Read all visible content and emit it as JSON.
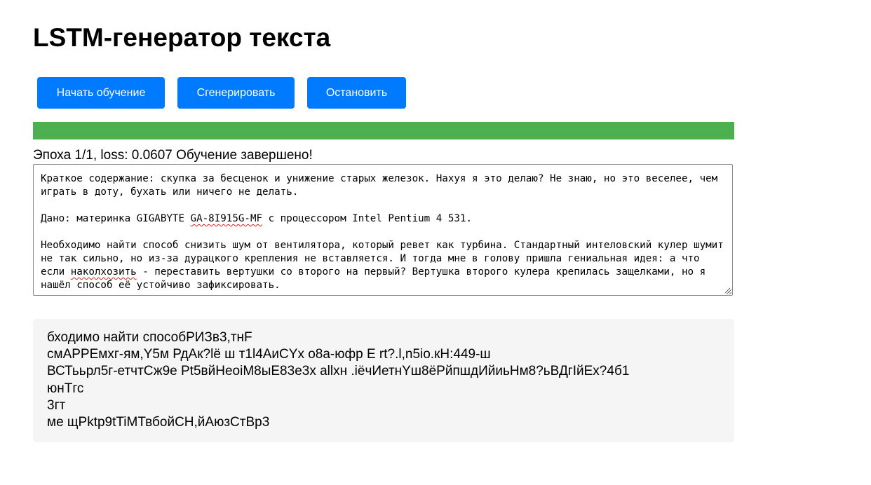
{
  "header": {
    "title": "LSTM-генератор текста"
  },
  "toolbar": {
    "start_label": "Начать обучение",
    "generate_label": "Сгенерировать",
    "stop_label": "Остановить"
  },
  "progress": {
    "fraction": 1.0,
    "color": "#4caf50"
  },
  "status": {
    "text": "Эпоха 1/1, loss: 0.0607 Обучение завершено!"
  },
  "training_text": {
    "p1": "Краткое содержание: скупка за бесценок и унижение старых железок. Нахуя я это делаю? Не знаю, но это веселее, чем играть в доту, бухать или ничего не делать.",
    "p2_before": "Дано: материнка GIGABYTE ",
    "p2_model": "GA-8I915G-MF",
    "p2_after": " с процессором Intel Pentium 4 531.",
    "p3_before": "Необходимо найти способ снизить шум от вентилятора, который ревет как турбина. Стандартный интеловский кулер шумит не так сильно, но из-за дурацкого крепления не вставляется. И тогда мне в голову пришла гениальная идея: а что если ",
    "p3_word": "наколхозить",
    "p3_after": " - переставить вертушки со второго на первый? Вертушка второго кулера крепилась защелками, но я нашёл способ её устойчиво зафиксировать."
  },
  "output": {
    "lines": [
      "бходимо найти способРИЗв3,тнF",
      "смАРРЕмхг-ям,Y5м РдАк?lё ш т1l4АиСYх о8а-юфр Е rt?.l,n5io.кН:449-ш",
      "ВСТььрл5г-етчтСж9е Pt5вйНеоiМ8ыЕ83е3х allхн .iёчИетнYш8ёРйпшдИйиьНм8?ьВДгIйЕх?4б1",
      "юнТгс",
      "3гт",
      "ме щРktp9tTiМТвбойСН,йАюзСтВр3"
    ]
  }
}
